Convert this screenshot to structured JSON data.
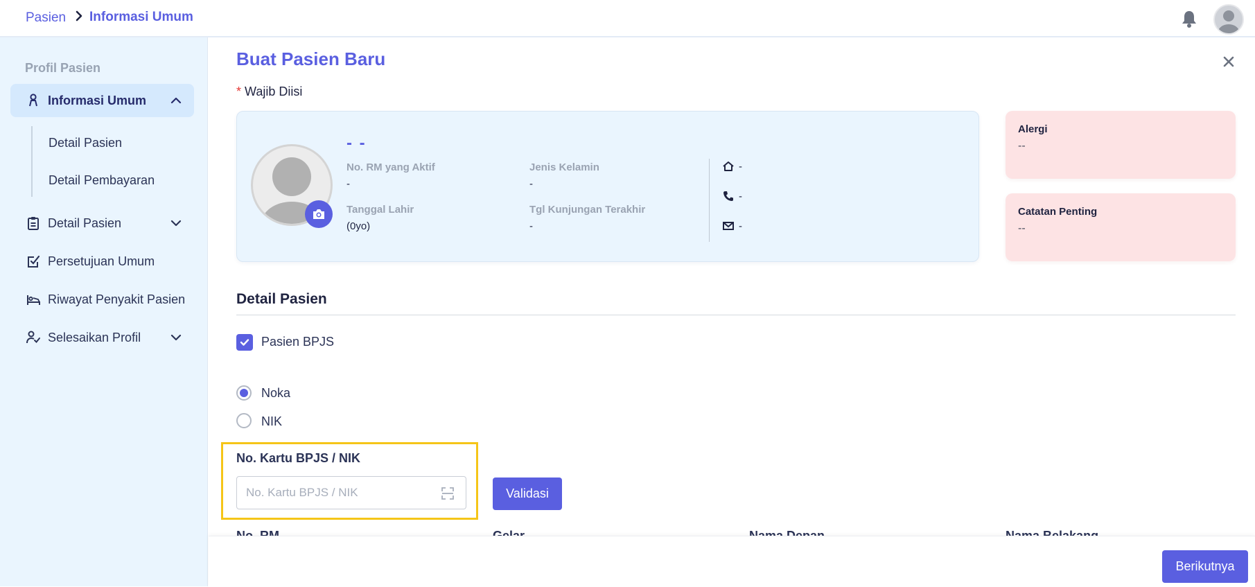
{
  "breadcrumb": {
    "parent": "Pasien",
    "current": "Informasi Umum"
  },
  "sidebar": {
    "title": "Profil Pasien",
    "items": [
      {
        "label": "Informasi Umum",
        "icon": "person-icon",
        "expanded": true,
        "active": true
      },
      {
        "label": "Detail Pasien",
        "icon": "clipboard-icon",
        "expanded": false
      },
      {
        "label": "Persetujuan Umum",
        "icon": "checkbox-edit-icon"
      },
      {
        "label": "Riwayat Penyakit Pasien",
        "icon": "bed-icon"
      },
      {
        "label": "Selesaikan Profil",
        "icon": "user-check-icon",
        "expanded": false
      }
    ],
    "sub_items": [
      "Detail Pasien",
      "Detail Pembayaran"
    ]
  },
  "page": {
    "title": "Buat Pasien Baru",
    "required_note": "Wajib Diisi",
    "required_mark": "*"
  },
  "profile": {
    "name": "- -",
    "fields": [
      {
        "label": "No. RM yang Aktif",
        "value": "-"
      },
      {
        "label": "Jenis Kelamin",
        "value": "-"
      },
      {
        "label": "Tanggal Lahir",
        "value": "(0yo)"
      },
      {
        "label": "Tgl Kunjungan Terakhir",
        "value": "-"
      }
    ],
    "contact": {
      "address": "-",
      "phone": "-",
      "email": "-"
    }
  },
  "notes": [
    {
      "title": "Alergi",
      "value": "--"
    },
    {
      "title": "Catatan Penting",
      "value": "--"
    }
  ],
  "detail_section": {
    "title": "Detail Pasien",
    "bpjs_checkbox": {
      "label": "Pasien BPJS",
      "checked": true
    },
    "id_type": {
      "options": [
        "Noka",
        "NIK"
      ],
      "selected": "Noka"
    },
    "card_field": {
      "label": "No. Kartu BPJS / NIK",
      "placeholder": "No. Kartu BPJS / NIK",
      "value": ""
    },
    "validate_label": "Validasi",
    "next_columns": [
      "No. RM",
      "Gelar",
      "Nama Depan",
      "Nama Belakang"
    ]
  },
  "footer": {
    "next_label": "Berikutnya"
  },
  "colors": {
    "accent": "#5a5fe0",
    "sidebar_bg": "#eaf5fe",
    "note_bg": "#fde3e4",
    "highlight": "#f5c518"
  }
}
